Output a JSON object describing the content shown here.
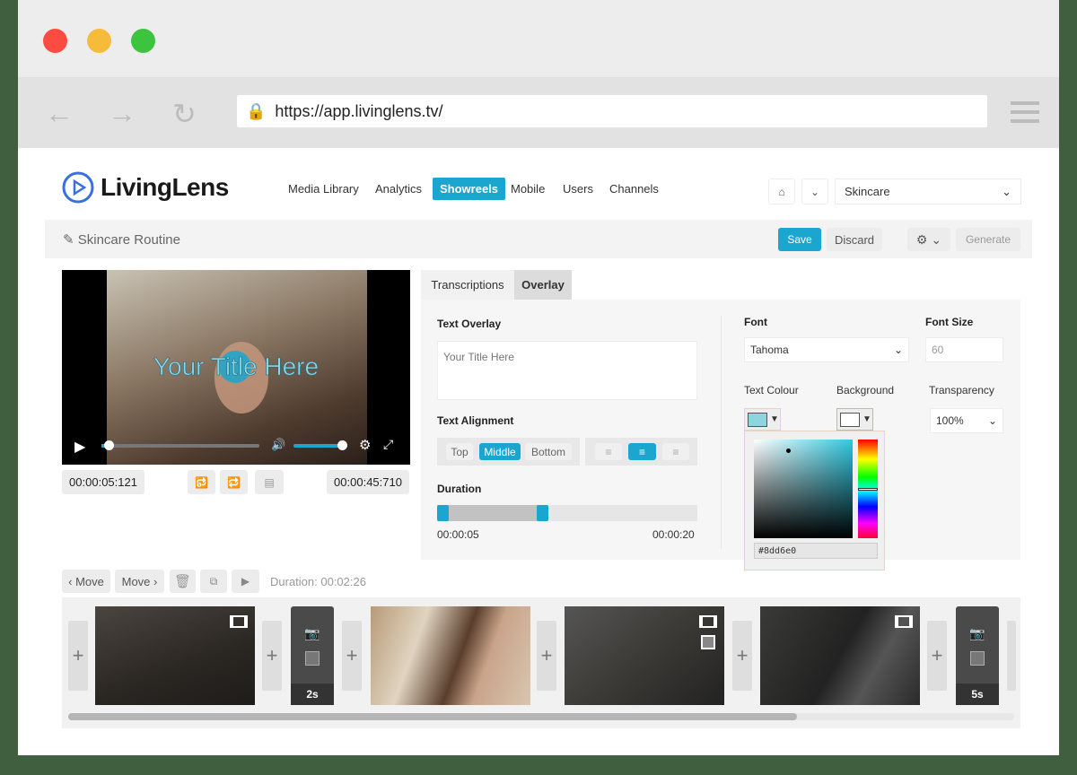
{
  "browser": {
    "url": "https://app.livinglens.tv/"
  },
  "app": {
    "logo": "LivingLens",
    "nav": [
      "Media Library",
      "Analytics",
      "Showreels",
      "Mobile",
      "Users",
      "Channels"
    ],
    "active_nav": "Showreels",
    "channel_select": "Skincare"
  },
  "toolbar": {
    "title": "Skincare Routine",
    "save": "Save",
    "discard": "Discard",
    "generate": "Generate"
  },
  "player": {
    "overlay_text": "Your Title Here",
    "current_time": "00:00:05:121",
    "total_time": "00:00:45:710",
    "progress": 0.03,
    "volume": 1.0
  },
  "tabs": [
    "Transcriptions",
    "Overlay"
  ],
  "active_tab": "Overlay",
  "overlay": {
    "text_label": "Text Overlay",
    "text_placeholder": "Your Title Here",
    "alignment_label": "Text Alignment",
    "valign": [
      "Top",
      "Middle",
      "Bottom"
    ],
    "valign_selected": "Middle",
    "halign_selected": "center",
    "duration_label": "Duration",
    "duration_start": "00:00:05",
    "duration_end": "00:00:20",
    "font_label": "Font",
    "font_value": "Tahoma",
    "size_label": "Font Size",
    "size_value": "60",
    "text_colour_label": "Text Colour",
    "background_label": "Background",
    "transparency_label": "Transparency",
    "transparency_value": "100%",
    "colour_hex": "#8dd6e0"
  },
  "timeline": {
    "move_left": "Move",
    "move_right": "Move",
    "duration": "Duration: 00:02:26",
    "stills": [
      "2s",
      "5s"
    ],
    "scroll": 0.75
  },
  "colors": {
    "accent": "#1aa6cf",
    "text_colour": "#8dd6e0"
  }
}
